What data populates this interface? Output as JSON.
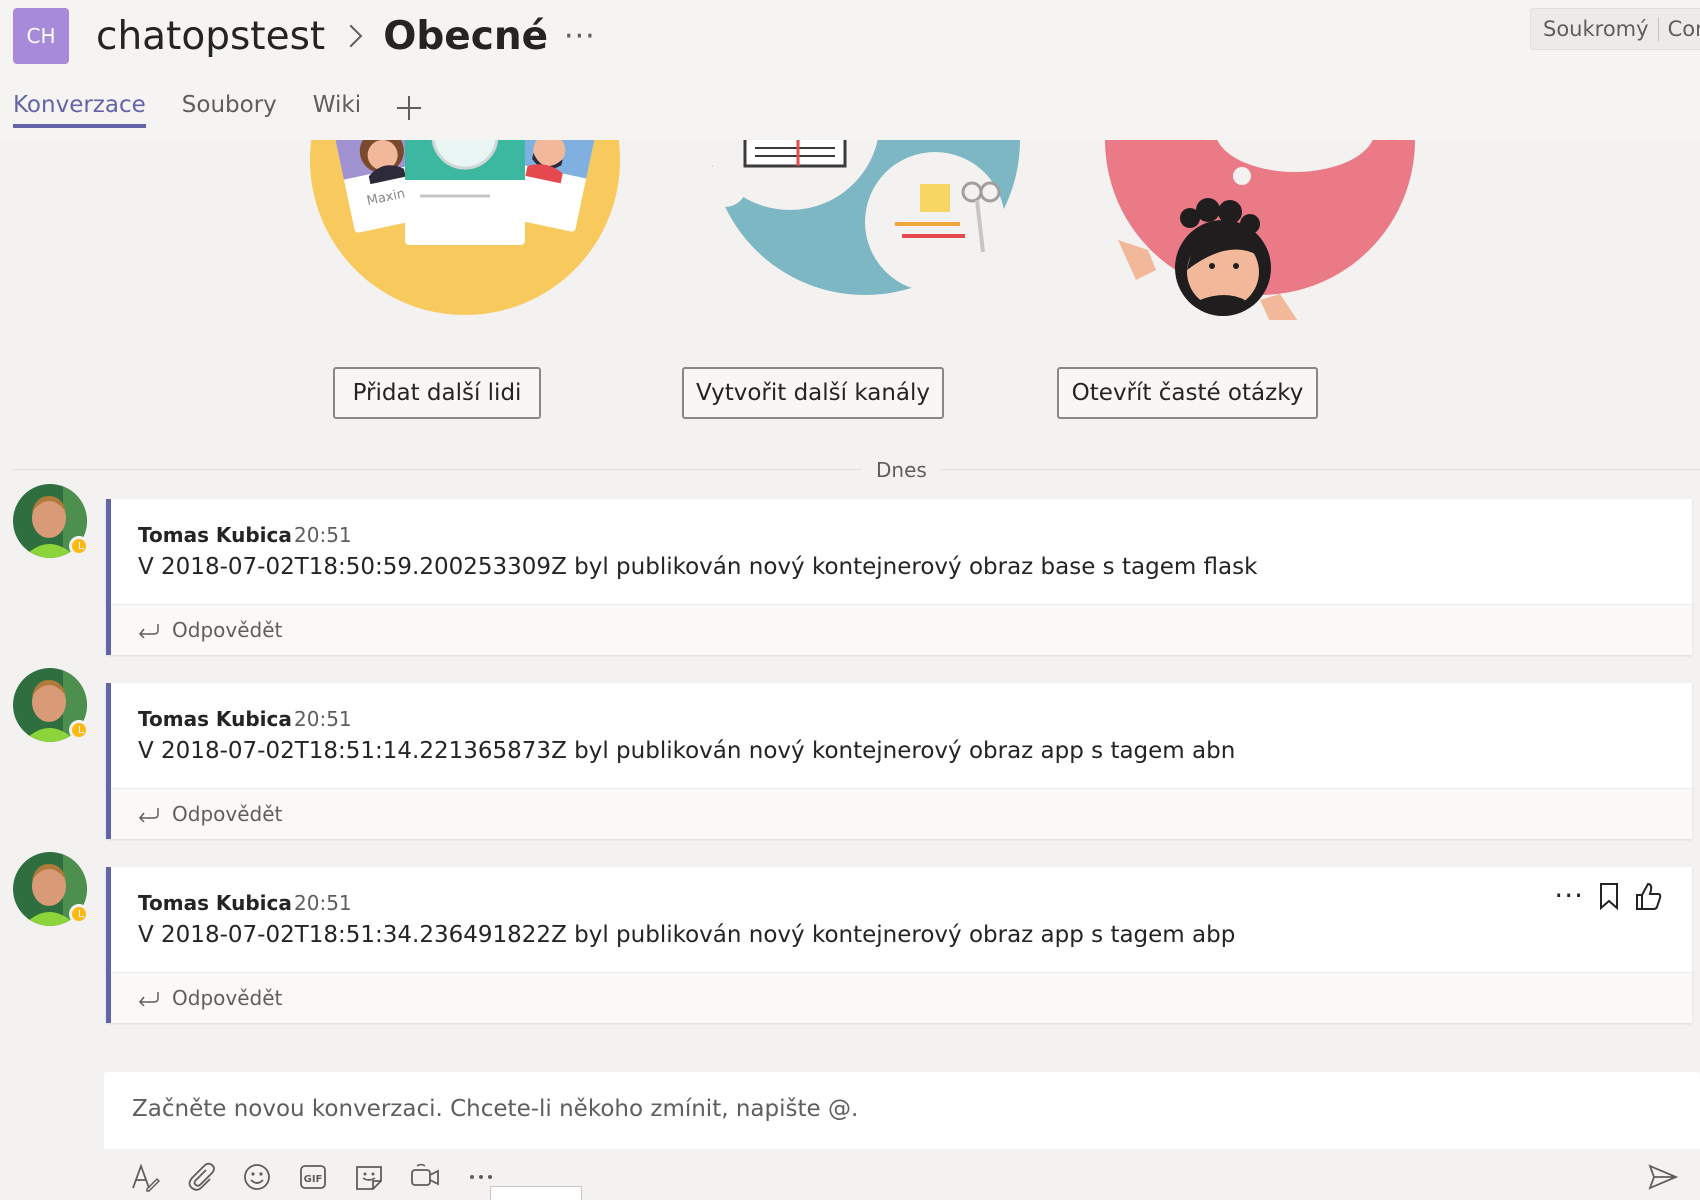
{
  "header": {
    "team_avatar": "CH",
    "team_name": "chatopstest",
    "channel_name": "Obecné",
    "channel_more": "···",
    "privacy_label": "Soukromý",
    "privacy_label_2": "Conf"
  },
  "tabs": [
    {
      "label": "Konverzace",
      "active": true
    },
    {
      "label": "Soubory",
      "active": false
    },
    {
      "label": "Wiki",
      "active": false
    }
  ],
  "welcome": {
    "card_name": "Maxine",
    "buttons": [
      "Přidat další lidi",
      "Vytvořit další kanály",
      "Otevřít časté otázky"
    ]
  },
  "divider_label": "Dnes",
  "messages": [
    {
      "author": "Tomas Kubica",
      "time": "20:51",
      "text": "V 2018-07-02T18:50:59.200253309Z byl publikován nový kontejnerový obraz base s tagem flask",
      "reply": "Odpovědět"
    },
    {
      "author": "Tomas Kubica",
      "time": "20:51",
      "text": "V 2018-07-02T18:51:14.221365873Z byl publikován nový kontejnerový obraz app s tagem abn",
      "reply": "Odpovědět"
    },
    {
      "author": "Tomas Kubica",
      "time": "20:51",
      "text": "V 2018-07-02T18:51:34.236491822Z byl publikován nový kontejnerový obraz app s tagem abp",
      "reply": "Odpovědět"
    }
  ],
  "message_actions": {
    "more": "···"
  },
  "compose": {
    "placeholder": "Začněte novou konverzaci. Chcete-li někoho zmínit, napište @."
  },
  "toolbar_icons": [
    "format-icon",
    "attach-icon",
    "emoji-icon",
    "gif-icon",
    "sticker-icon",
    "meet-now-icon",
    "more-options-icon",
    "send-icon"
  ],
  "colors": {
    "accent": "#6264a7",
    "background": "#f3f2f1",
    "status_away": "#fdb913"
  }
}
